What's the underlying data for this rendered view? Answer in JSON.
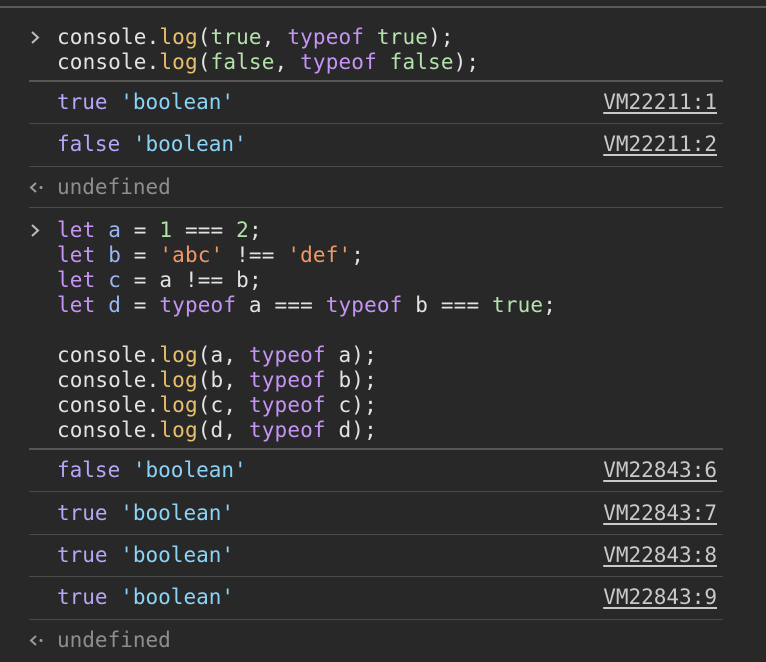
{
  "colors": {
    "background": "#282828",
    "text": "#e3e3e3",
    "function": "#e7c06c",
    "keyword": "#c594f5",
    "variable": "#9ab6f5",
    "number": "#b3e2ab",
    "string": "#f29766",
    "output_boolean": "#b9a5f7",
    "output_string": "#8cd3f8",
    "link": "#c9c9c9",
    "undefined": "#8e8e8e"
  },
  "entry1": {
    "line1": {
      "obj": "console",
      "dot": ".",
      "fn": "log",
      "open": "(",
      "a1": "true",
      "comma": ", ",
      "kw": "typeof",
      "sp": " ",
      "a2": "true",
      "close": ");"
    },
    "line2": {
      "obj": "console",
      "dot": ".",
      "fn": "log",
      "open": "(",
      "a1": "false",
      "comma": ", ",
      "kw": "typeof",
      "sp": " ",
      "a2": "false",
      "close": ");"
    },
    "outputs": [
      {
        "value": "true",
        "type": "'boolean'",
        "source": "VM22211:1"
      },
      {
        "value": "false",
        "type": "'boolean'",
        "source": "VM22211:2"
      }
    ],
    "result": "undefined"
  },
  "entry2": {
    "lines": {
      "a": {
        "let": "let",
        "name": "a",
        "eq": " = ",
        "n1": "1",
        "op": " === ",
        "n2": "2",
        "end": ";"
      },
      "b": {
        "let": "let",
        "name": "b",
        "eq": " = ",
        "s1": "'abc'",
        "op": " !== ",
        "s2": "'def'",
        "end": ";"
      },
      "c": {
        "let": "let",
        "name": "c",
        "eq": " = ",
        "v1": "a",
        "op": " !== ",
        "v2": "b",
        "end": ";"
      },
      "d": {
        "let": "let",
        "name": "d",
        "eq": " = ",
        "t1": "typeof",
        "v1": " a",
        "op1": " === ",
        "t2": "typeof",
        "v2": " b",
        "op2": " === ",
        "bool": "true",
        "end": ";"
      }
    },
    "logs": [
      {
        "obj": "console",
        "dot": ".",
        "fn": "log",
        "open": "(",
        "arg": "a",
        "comma": ", ",
        "kw": "typeof",
        "arg2": " a",
        "close": ");"
      },
      {
        "obj": "console",
        "dot": ".",
        "fn": "log",
        "open": "(",
        "arg": "b",
        "comma": ", ",
        "kw": "typeof",
        "arg2": " b",
        "close": ");"
      },
      {
        "obj": "console",
        "dot": ".",
        "fn": "log",
        "open": "(",
        "arg": "c",
        "comma": ", ",
        "kw": "typeof",
        "arg2": " c",
        "close": ");"
      },
      {
        "obj": "console",
        "dot": ".",
        "fn": "log",
        "open": "(",
        "arg": "d",
        "comma": ", ",
        "kw": "typeof",
        "arg2": " d",
        "close": ");"
      }
    ],
    "outputs": [
      {
        "value": "false",
        "type": "'boolean'",
        "source": "VM22843:6"
      },
      {
        "value": "true",
        "type": "'boolean'",
        "source": "VM22843:7"
      },
      {
        "value": "true",
        "type": "'boolean'",
        "source": "VM22843:8"
      },
      {
        "value": "true",
        "type": "'boolean'",
        "source": "VM22843:9"
      }
    ],
    "result": "undefined"
  },
  "icons": {
    "prompt": "chevron-right-icon",
    "return": "return-arrow-icon"
  }
}
